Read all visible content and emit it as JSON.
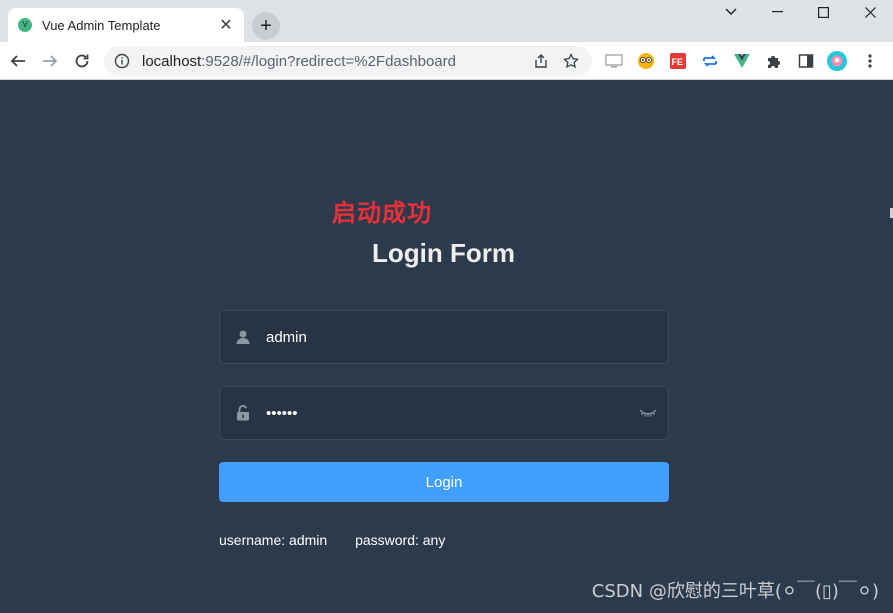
{
  "browser": {
    "tab_title": "Vue Admin Template",
    "favicon_letter": "V",
    "close_label": "✕",
    "newtab_label": "+",
    "url_host": "localhost",
    "url_path": ":9528/#/login?redirect=%2Fdashboard"
  },
  "icons": {
    "back": "back-arrow-icon",
    "forward": "forward-arrow-icon",
    "reload": "reload-icon",
    "info": "info-icon",
    "share": "share-icon",
    "star": "bookmark-star-icon",
    "extensions": [
      "screen-cast-icon",
      "owl-icon",
      "fe-icon",
      "sync-icon",
      "vue-devtools-icon",
      "puzzle-icon",
      "side-panel-icon",
      "profile-avatar-icon",
      "menu-kebab-icon"
    ]
  },
  "overlay_text": "启动成功",
  "login": {
    "title": "Login Form",
    "username_value": "admin",
    "password_value": "••••••",
    "button_label": "Login",
    "tip_username": "username: admin",
    "tip_password": "password: any"
  },
  "watermark": "CSDN @欣慰的三叶草(⚪￣(▯)￣⚪)",
  "colors": {
    "page_bg": "#2d3a4b",
    "button": "#409eff",
    "overlay_red": "#e8303a"
  }
}
